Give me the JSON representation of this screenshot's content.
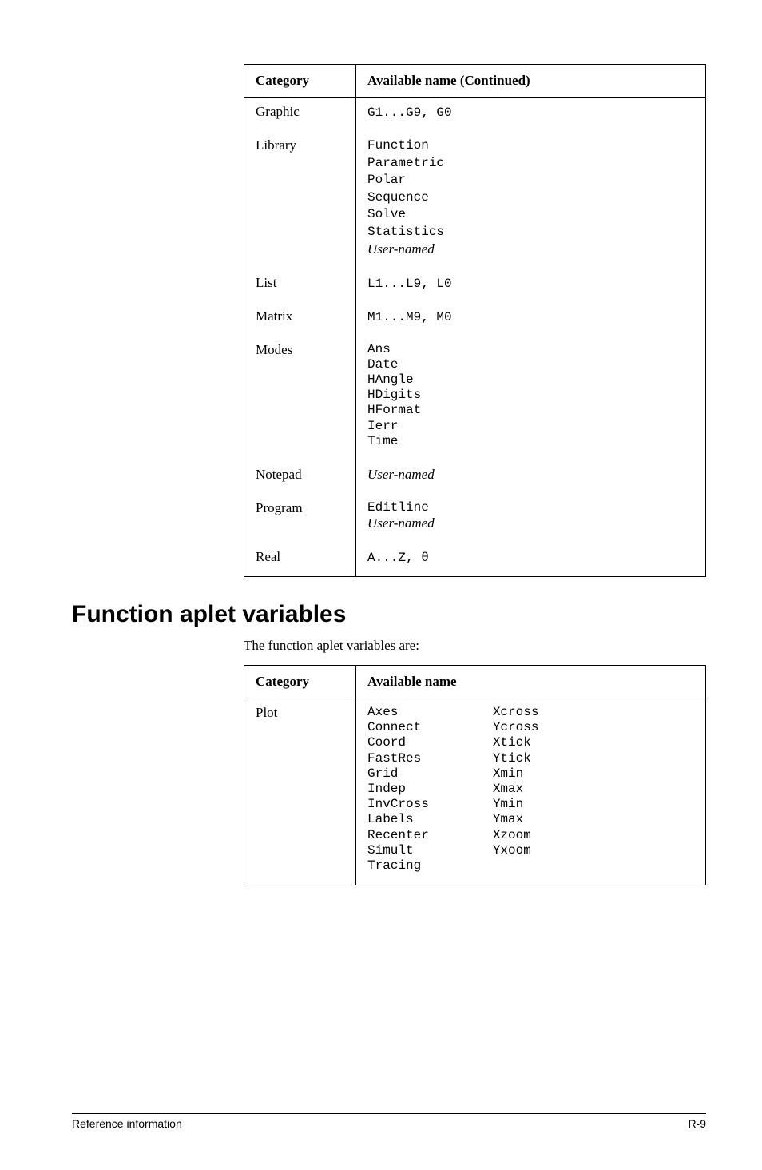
{
  "table1": {
    "headers": {
      "category": "Category",
      "available": "Available name  (Continued)"
    },
    "rows": [
      {
        "category": "Graphic",
        "content_mono": "G1...G9, G0"
      },
      {
        "category": "Library",
        "content_lines": [
          "Function",
          "Parametric",
          "Polar",
          "Sequence",
          "Solve",
          "Statistics"
        ],
        "content_italic": "User-named"
      },
      {
        "category": "List",
        "content_mono": "L1...L9, L0"
      },
      {
        "category": "Matrix",
        "content_mono": "M1...M9, M0"
      },
      {
        "category": "Modes",
        "content_lines": [
          "Ans",
          "Date",
          "HAngle",
          "HDigits",
          "HFormat",
          "Ierr",
          "Time"
        ]
      },
      {
        "category": "Notepad",
        "content_italic": "User-named"
      },
      {
        "category": "Program",
        "content_lines": [
          "Editline"
        ],
        "content_italic": "User-named"
      },
      {
        "category": "Real",
        "content_mono": "A...Z,  θ"
      }
    ]
  },
  "heading": "Function aplet variables",
  "intro": "The function aplet variables are:",
  "table2": {
    "headers": {
      "category": "Category",
      "available": "Available name"
    },
    "rows": [
      {
        "category": "Plot",
        "col1": [
          "Axes",
          "Connect",
          "Coord",
          "FastRes",
          "Grid",
          "Indep",
          "InvCross",
          "Labels",
          "Recenter",
          "Simult",
          "Tracing"
        ],
        "col2": [
          "Xcross",
          "Ycross",
          "Xtick",
          "Ytick",
          "Xmin",
          "Xmax",
          "Ymin",
          "Ymax",
          "Xzoom",
          "Yxoom"
        ]
      }
    ]
  },
  "footer": {
    "left": "Reference information",
    "right": "R-9"
  }
}
